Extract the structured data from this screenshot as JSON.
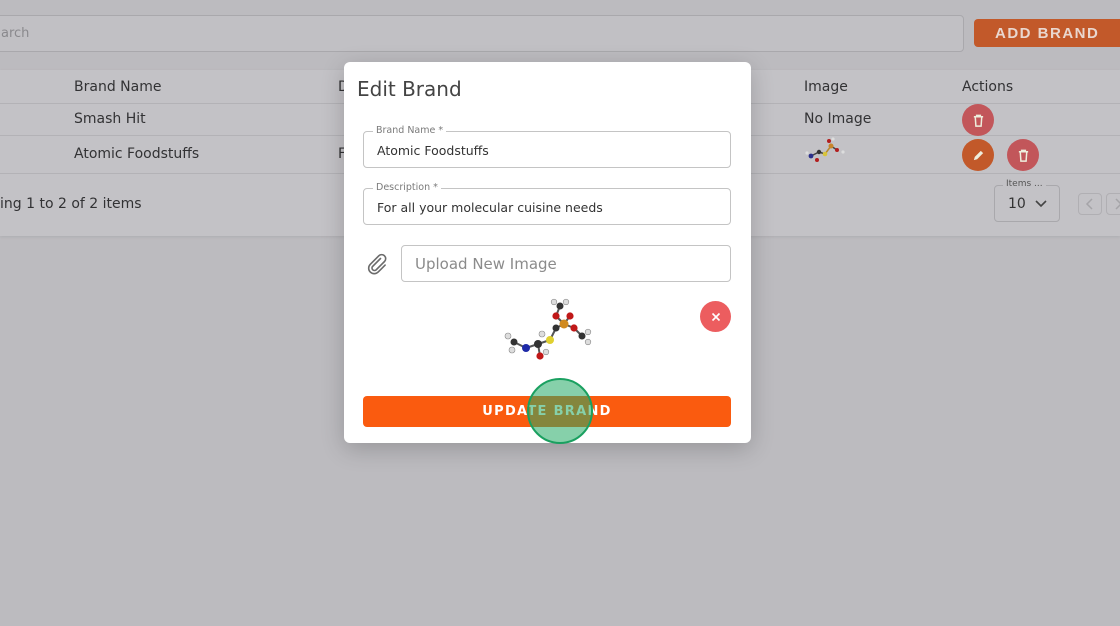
{
  "search": {
    "placeholder": "arch"
  },
  "toolbar": {
    "add_brand_label": "ADD BRAND"
  },
  "table": {
    "headers": {
      "brand_name": "Brand Name",
      "description": "D",
      "image": "Image",
      "actions": "Actions"
    },
    "rows": [
      {
        "brand_name": "Smash Hit",
        "description": "",
        "image": "No Image"
      },
      {
        "brand_name": "Atomic Foodstuffs",
        "description": "F",
        "image": ""
      }
    ]
  },
  "pagination": {
    "summary": "ing 1 to 2 of 2 items",
    "items_label": "Items ...",
    "items_value": "10"
  },
  "modal": {
    "title": "Edit Brand",
    "brand_name_label": "Brand Name *",
    "brand_name_value": "Atomic Foodstuffs",
    "description_label": "Description *",
    "description_value": "For all your molecular cuisine needs",
    "upload_placeholder": "Upload New Image",
    "update_label": "UPDATE BRAND"
  },
  "colors": {
    "accent": "#fa5b0f",
    "delete": "#ec5d5f",
    "overlay": "#bcbbbf"
  },
  "icons": [
    "trash-icon",
    "pencil-icon",
    "chevron-down-icon",
    "chevron-left-icon",
    "chevron-right-icon",
    "paperclip-icon",
    "close-icon"
  ]
}
